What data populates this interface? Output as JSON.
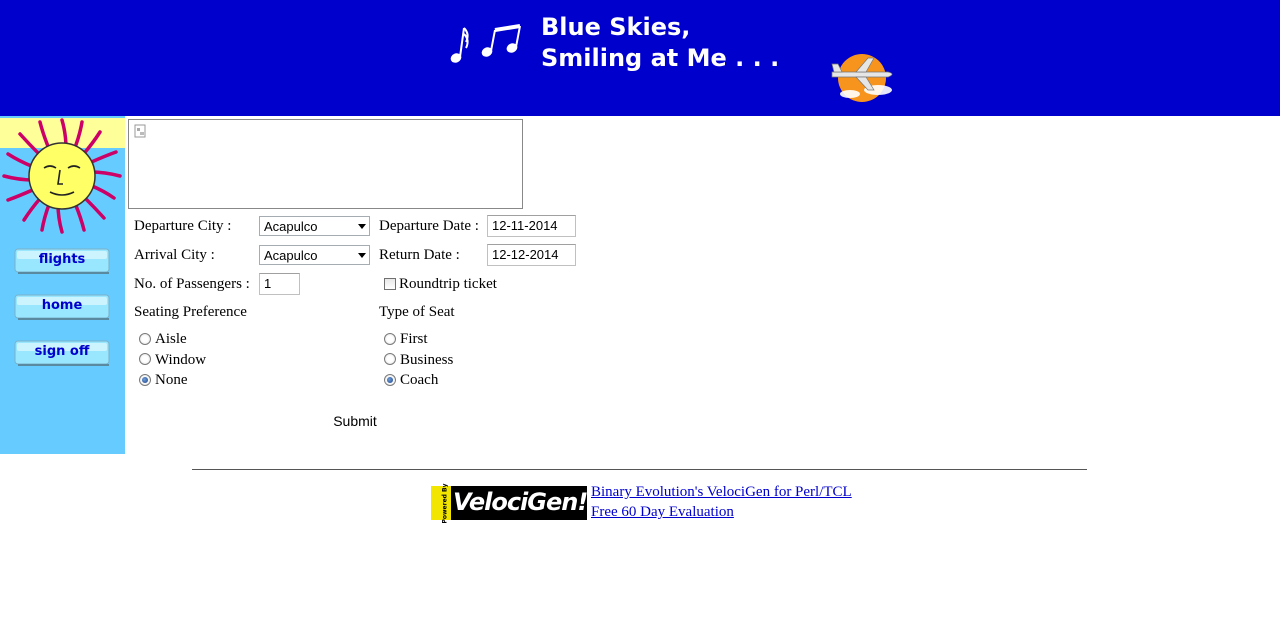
{
  "banner": {
    "title_line1": "Blue Skies,",
    "title_line2": "Smiling at Me . . ."
  },
  "sidebar": {
    "items": [
      {
        "label": "flights"
      },
      {
        "label": "home"
      },
      {
        "label": "sign off"
      }
    ]
  },
  "form": {
    "departure_city_label": "Departure City :",
    "departure_city_value": "Acapulco",
    "departure_date_label": "Departure Date :",
    "departure_date_value": "12-11-2014",
    "arrival_city_label": "Arrival City :",
    "arrival_city_value": "Acapulco",
    "return_date_label": "Return Date :",
    "return_date_value": "12-12-2014",
    "passengers_label": "No. of Passengers :",
    "passengers_value": "1",
    "roundtrip_label": "Roundtrip ticket",
    "seating_label": "Seating Preference",
    "seating_options": [
      {
        "label": "Aisle",
        "selected": false
      },
      {
        "label": "Window",
        "selected": false
      },
      {
        "label": "None",
        "selected": true
      }
    ],
    "seat_type_label": "Type of Seat",
    "seat_type_options": [
      {
        "label": "First",
        "selected": false
      },
      {
        "label": "Business",
        "selected": false
      },
      {
        "label": "Coach",
        "selected": true
      }
    ],
    "submit_label": "Submit"
  },
  "footer": {
    "logo_powered": "Powered By",
    "logo_name": "VelociGen!",
    "link1": "Binary Evolution's VelociGen for Perl/TCL",
    "link2": "Free 60 Day Evaluation"
  },
  "colors": {
    "banner_bg": "#0000cc",
    "sidebar_bg": "#66ccff",
    "link": "#0000cc"
  }
}
